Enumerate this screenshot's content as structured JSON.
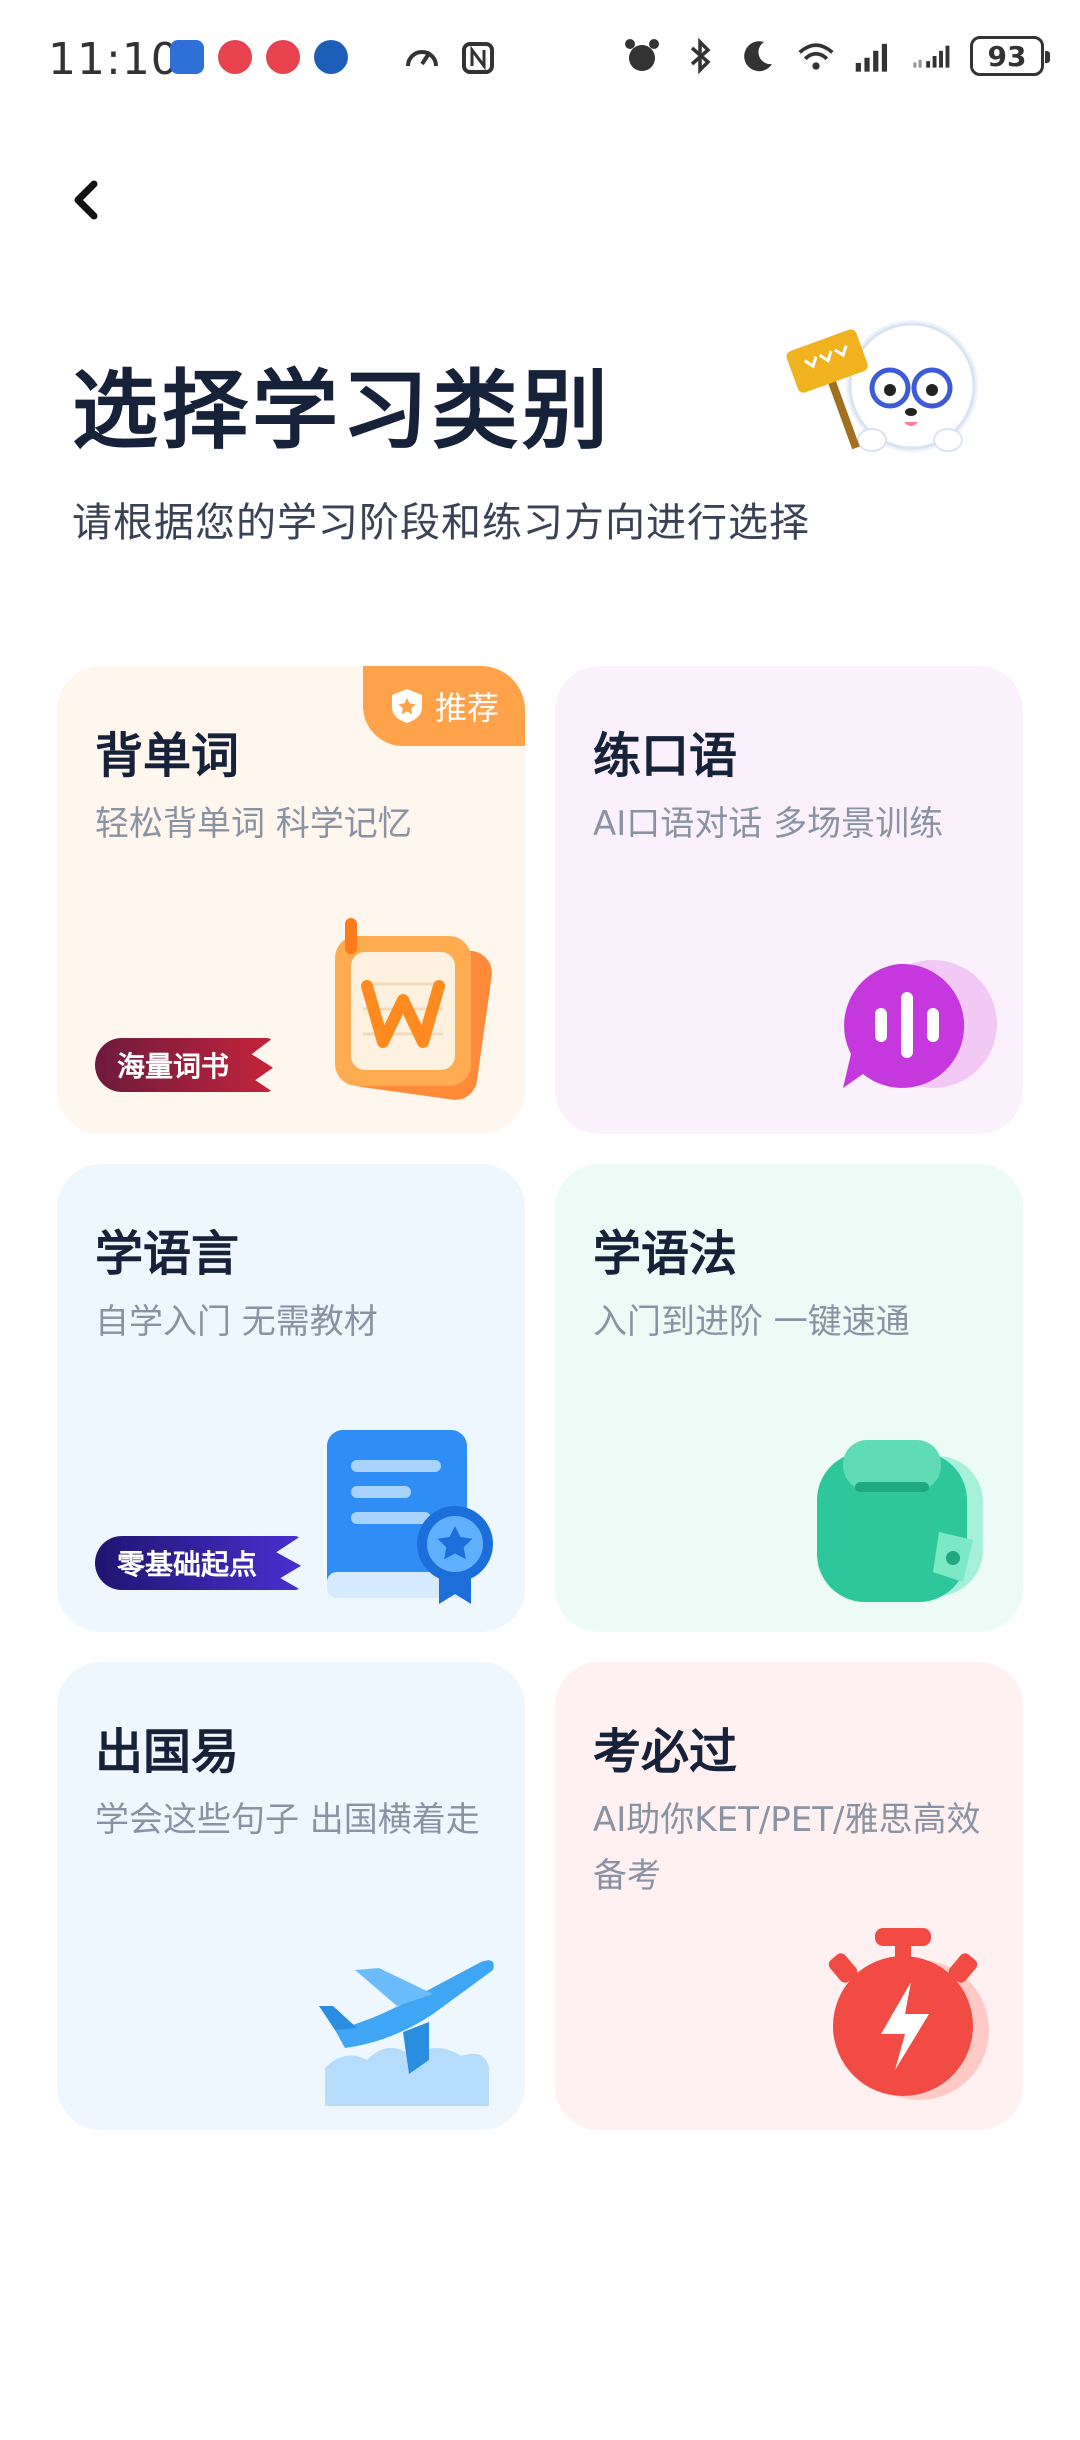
{
  "status_bar": {
    "time": "11:10",
    "battery": "93"
  },
  "header": {
    "title": "选择学习类别",
    "subtitle": "请根据您的学习阶段和练习方向进行选择"
  },
  "cards": [
    {
      "title": "背单词",
      "desc": "轻松背单词 科学记忆",
      "tag": "海量词书",
      "badge": "推荐",
      "bg": "#fff6ee",
      "icon": "word-book-icon"
    },
    {
      "title": "练口语",
      "desc": "AI口语对话 多场景训练",
      "bg": "#fbf1fd",
      "icon": "voice-chat-icon"
    },
    {
      "title": "学语言",
      "desc": "自学入门 无需教材",
      "tag": "零基础起点",
      "bg": "#eef6fe",
      "icon": "textbook-icon"
    },
    {
      "title": "学语法",
      "desc": "入门到进阶 一键速通",
      "bg": "#ecfbf6",
      "icon": "grammar-bag-icon"
    },
    {
      "title": "出国易",
      "desc": "学会这些句子 出国横着走",
      "bg": "#eef6fe",
      "icon": "airplane-icon"
    },
    {
      "title": "考必过",
      "desc": "AI助你KET/PET/雅思高效备考",
      "bg": "#fff1f1",
      "icon": "stopwatch-icon"
    }
  ],
  "colors": {
    "badge": "#ffa24a",
    "tag_vocab": "#7a1c3c",
    "tag_lang": "#2a1a7a"
  }
}
